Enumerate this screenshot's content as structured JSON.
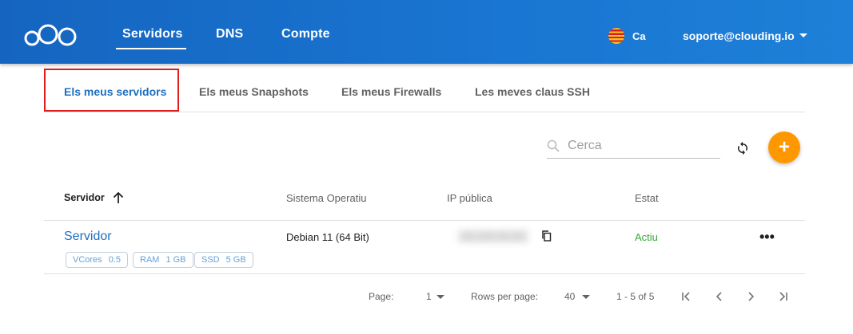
{
  "header": {
    "nav": [
      {
        "label": "Servidors",
        "active": true
      },
      {
        "label": "DNS",
        "active": false
      },
      {
        "label": "Compte",
        "active": false
      }
    ],
    "language": "Ca",
    "user_email": "soporte@clouding.io"
  },
  "tabs": [
    {
      "label": "Els meus servidors",
      "active": true
    },
    {
      "label": "Els meus Snapshots",
      "active": false
    },
    {
      "label": "Els meus Firewalls",
      "active": false
    },
    {
      "label": "Les meves claus SSH",
      "active": false
    }
  ],
  "toolbar": {
    "search_placeholder": "Cerca",
    "add_label": "+"
  },
  "table": {
    "columns": [
      "Servidor",
      "Sistema Operatiu",
      "IP pública",
      "Estat"
    ],
    "rows": [
      {
        "name": "Servidor",
        "chips": [
          {
            "label": "VCores",
            "value": "0.5"
          },
          {
            "label": "RAM",
            "value": "1 GB"
          },
          {
            "label": "SSD",
            "value": "5 GB"
          }
        ],
        "os": "Debian 11 (64 Bit)",
        "ip": "00.000.00.00",
        "status": "Actiu"
      }
    ]
  },
  "pagination": {
    "page_label": "Page:",
    "page_value": "1",
    "rows_label": "Rows per page:",
    "rows_value": "40",
    "range": "1 - 5 of 5"
  },
  "colors": {
    "header_bg": "#1976d2",
    "accent": "#1f6fbf",
    "fab": "#ff9800",
    "status_active": "#3aa63a",
    "highlight_box": "#e31a1a"
  }
}
